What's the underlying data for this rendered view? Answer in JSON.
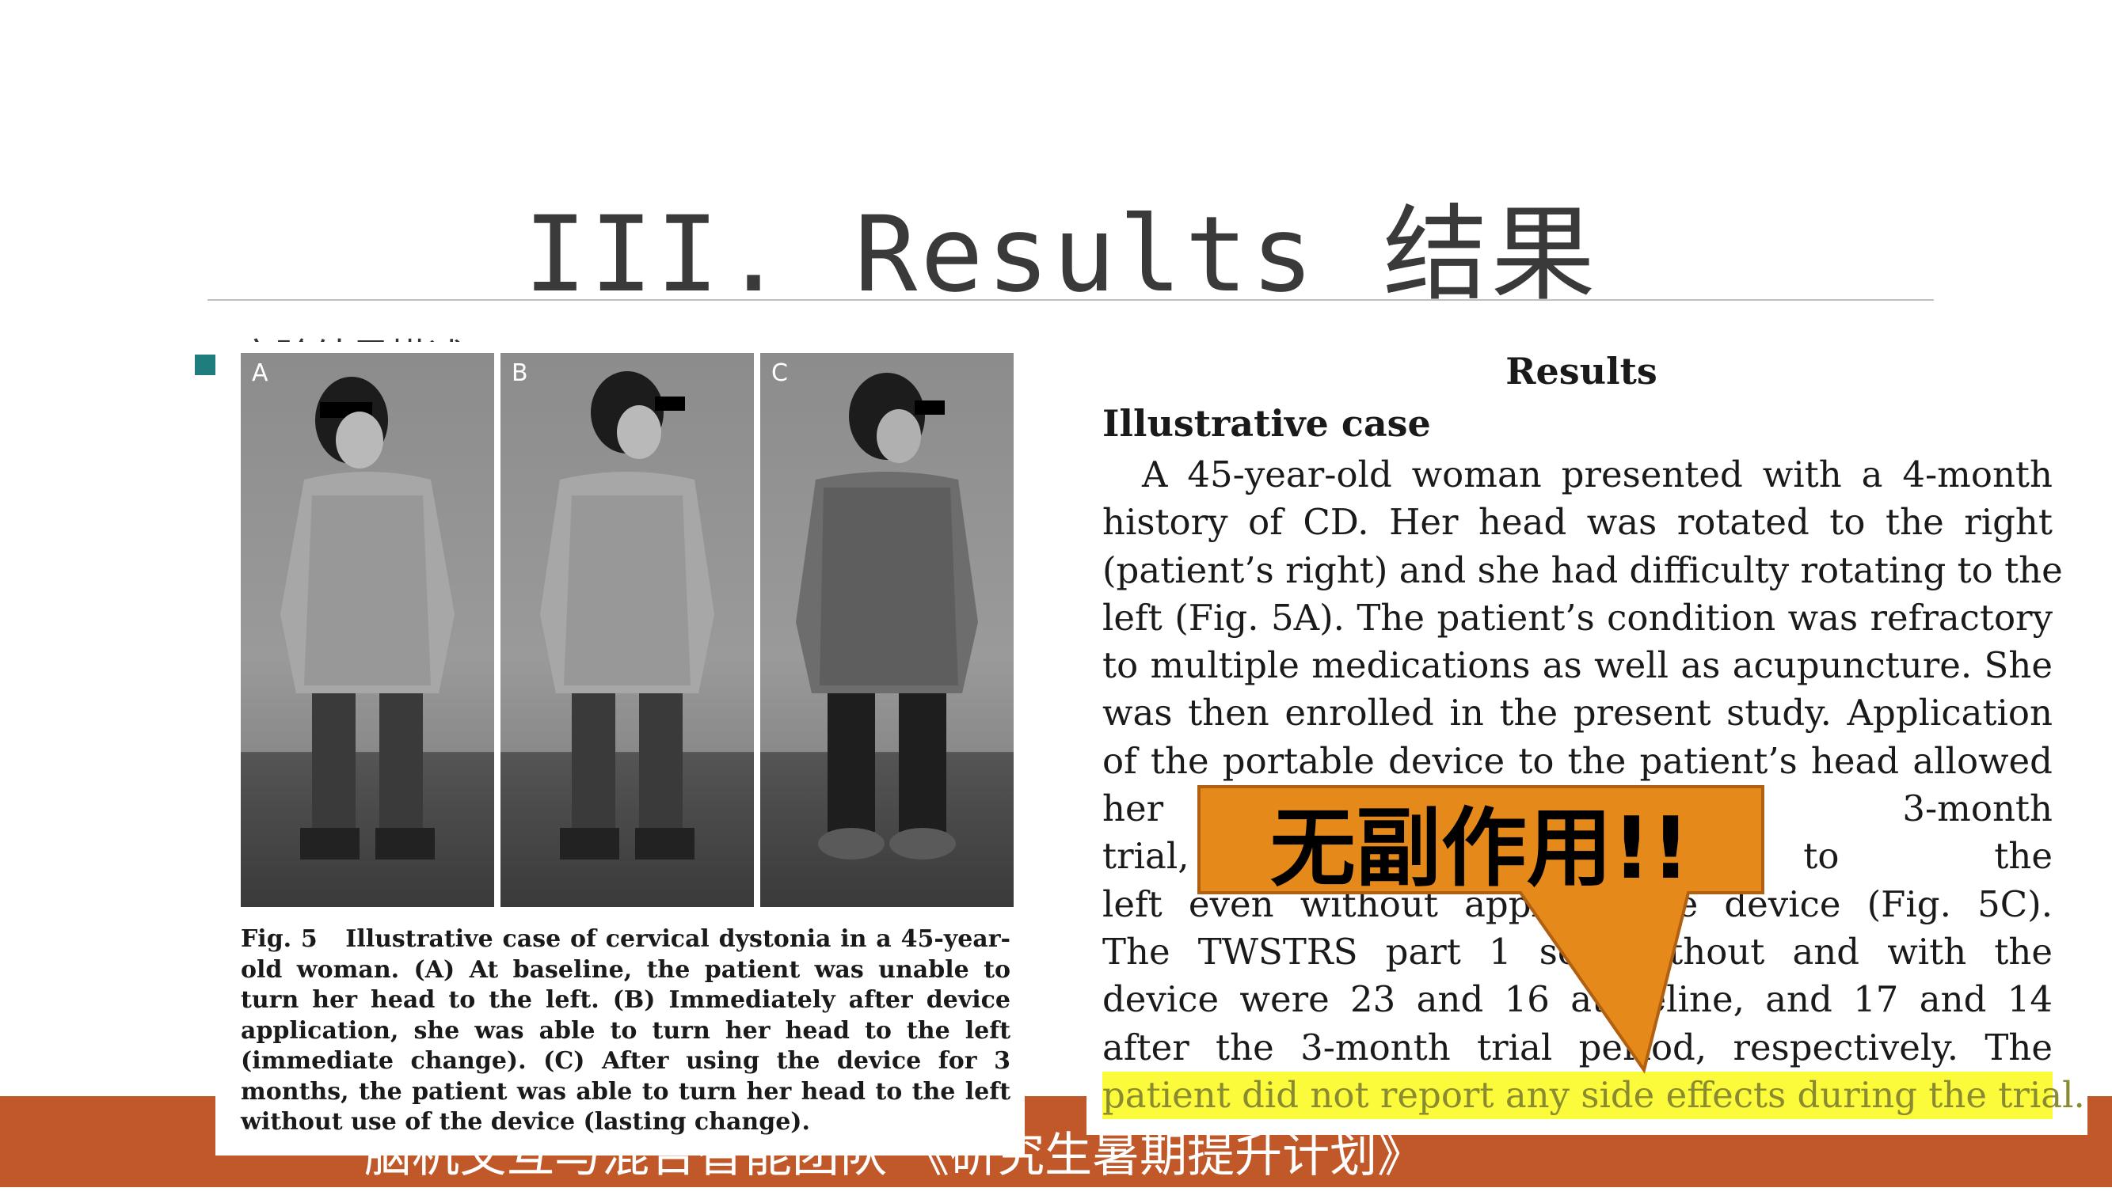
{
  "slide": {
    "title": "III. Results 结果",
    "bullet_text": "实验结果描述",
    "footer": "脑机交互与混合智能团队 《研究生暑期提升计划》"
  },
  "figure": {
    "panels": [
      "A",
      "B",
      "C"
    ],
    "caption_label": "Fig. 5",
    "caption_text": "Illustrative case of cervical dystonia in a 45-year-old woman. (A) At baseline, the patient was unable to turn her head to the left. (B) Immediately after device application, she was able to turn her head to the left (immediate change). (C) After using the device for 3 months, the patient was able to turn her head to the left without use of the device (lasting change)."
  },
  "article": {
    "section": "Results",
    "subsection": "Illustrative case",
    "lines": [
      "A 45-year-old woman presented with a 4-month",
      "history of CD. Her head was rotated to the right",
      "(patient’s right) and she had difficulty rotating to the",
      "left (Fig. 5A). The patient’s condition was refractory",
      "to multiple medications as well as acupuncture. She",
      "was then enrolled in the present study. Application",
      "of the portable device to the patient’s head allowed",
      "her t                                          fter the 3-month",
      "trial,                                        her head to the",
      "left even without applic              f the device (Fig. 5C).",
      "The TWSTRS part 1 sco              without and with the",
      "device were 23 and 16 at        seline, and 17 and 14",
      "after the 3-month trial period, respectively. The"
    ],
    "highlighted_line": "patient did not report any side effects during the trial."
  },
  "callout": {
    "label": "无副作用!!",
    "fill_color": "#e58a1a",
    "stroke_color": "#b06010"
  },
  "colors": {
    "footer": "#c0582a",
    "bullet": "#1f7d7d",
    "highlight": "#fbfb3c"
  }
}
